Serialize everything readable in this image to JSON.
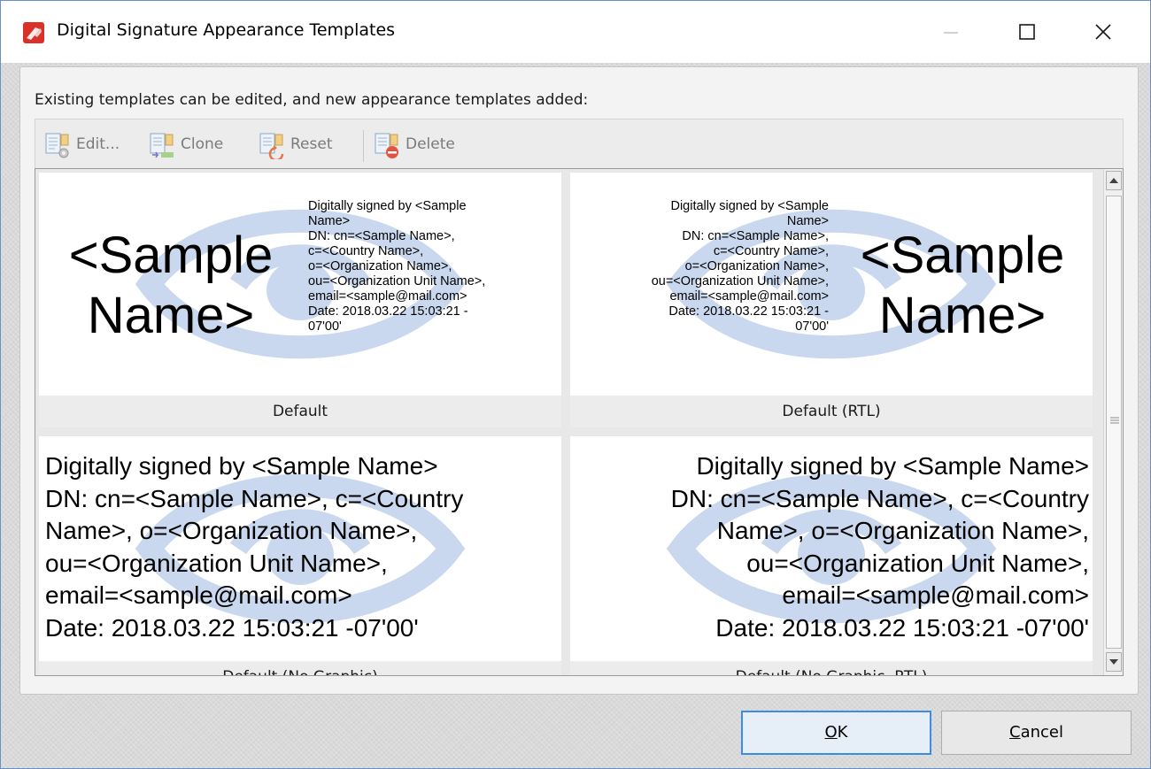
{
  "window": {
    "title": "Digital Signature Appearance Templates",
    "controls": {
      "minimize": "minimize",
      "maximize": "maximize",
      "close": "close"
    }
  },
  "instruction": "Existing templates can be edited, and new appearance templates added:",
  "toolbar": {
    "edit": {
      "label": "Edit...",
      "icon": "edit-template-icon",
      "enabled": false
    },
    "clone": {
      "label": "Clone",
      "icon": "clone-template-icon",
      "enabled": false
    },
    "reset": {
      "label": "Reset",
      "icon": "reset-template-icon",
      "enabled": false
    },
    "delete": {
      "label": "Delete",
      "icon": "delete-template-icon",
      "enabled": false
    }
  },
  "sample": {
    "big_name_line1": "<Sample",
    "big_name_line2": "Name>",
    "small_lines": [
      "Digitally signed by <Sample",
      "Name>",
      "DN: cn=<Sample Name>,",
      "c=<Country Name>,",
      "o=<Organization Name>,",
      "ou=<Organization Unit Name>,",
      "email=<sample@mail.com>",
      "Date: 2018.03.22 15:03:21 -",
      "07'00'"
    ],
    "full_lines_left": [
      "Digitally signed by <Sample Name>",
      "DN: cn=<Sample Name>, c=<Country",
      "Name>, o=<Organization Name>,",
      "ou=<Organization Unit Name>,",
      "email=<sample@mail.com>",
      "Date: 2018.03.22 15:03:21 -07'00'"
    ],
    "full_lines_right": [
      "Digitally signed by <Sample Name>",
      "DN: cn=<Sample Name>, c=<Country",
      "Name>, o=<Organization Name>,",
      "ou=<Organization Unit Name>,",
      "email=<sample@mail.com>",
      "Date: 2018.03.22 15:03:21 -07'00'"
    ]
  },
  "templates": [
    {
      "caption": "Default"
    },
    {
      "caption": "Default (RTL)"
    },
    {
      "caption": "Default (No Graphic)"
    },
    {
      "caption": "Default (No Graphic, RTL)"
    }
  ],
  "buttons": {
    "ok_prefix": "",
    "ok_mnemonic": "O",
    "ok_rest": "K",
    "cancel_mnemonic": "C",
    "cancel_rest": "ancel"
  },
  "colors": {
    "accent": "#3f8be0",
    "watermark": "#c9d8ee",
    "app_icon": "#d9302a"
  }
}
